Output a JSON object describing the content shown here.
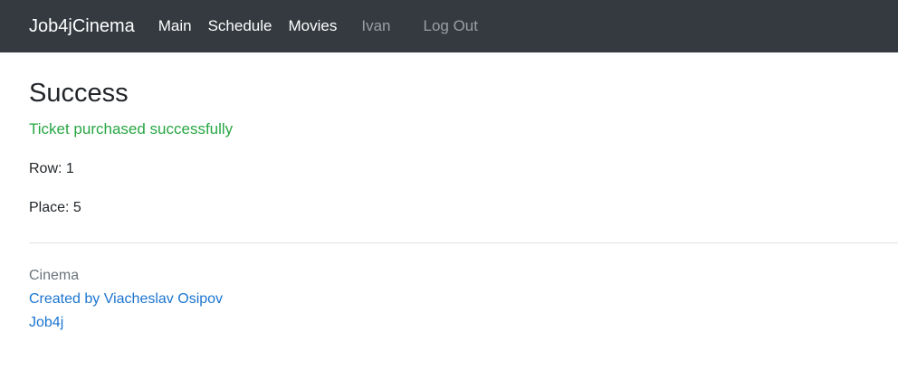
{
  "navbar": {
    "brand": "Job4jCinema",
    "links": [
      {
        "label": "Main"
      },
      {
        "label": "Schedule"
      },
      {
        "label": "Movies"
      }
    ],
    "user": "Ivan",
    "logout": "Log Out"
  },
  "main": {
    "title": "Success",
    "message": "Ticket purchased successfully",
    "row": "Row: 1",
    "place": "Place: 5"
  },
  "footer": {
    "title": "Cinema",
    "author_link": "Created by Viacheslav Osipov",
    "job4j_link": "Job4j"
  },
  "colors": {
    "navbar_bg": "#343a40",
    "success": "#28a745",
    "link": "#1b75d0",
    "muted": "#6c757d"
  }
}
